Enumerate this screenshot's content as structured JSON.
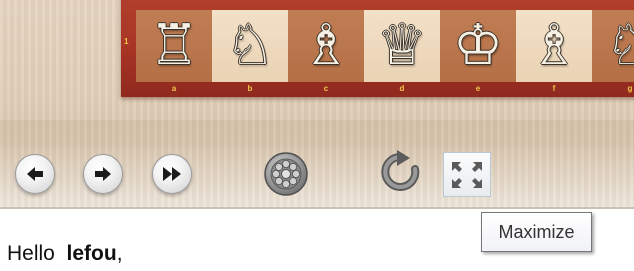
{
  "board": {
    "rank_label": "1",
    "squares": [
      {
        "file": "a",
        "piece": "♖",
        "piece_name": "rook-icon",
        "shade": "dark"
      },
      {
        "file": "b",
        "piece": "♘",
        "piece_name": "knight-icon",
        "shade": "light"
      },
      {
        "file": "c",
        "piece": "♗",
        "piece_name": "bishop-icon",
        "shade": "dark"
      },
      {
        "file": "d",
        "piece": "♕",
        "piece_name": "queen-icon",
        "shade": "light"
      },
      {
        "file": "e",
        "piece": "♔",
        "piece_name": "king-icon",
        "shade": "dark"
      },
      {
        "file": "f",
        "piece": "♗",
        "piece_name": "bishop-icon",
        "shade": "light"
      },
      {
        "file": "g",
        "piece": "♘",
        "piece_name": "knight-icon",
        "shade": "dark"
      }
    ]
  },
  "toolbar": {
    "buttons": [
      {
        "name": "back-button",
        "icon": "arrow-left-icon"
      },
      {
        "name": "forward-button",
        "icon": "arrow-right-icon"
      },
      {
        "name": "fast-forward-button",
        "icon": "fast-forward-icon"
      },
      {
        "name": "options-wheel-button",
        "icon": "wheel-icon"
      },
      {
        "name": "flip-board-button",
        "icon": "rotate-icon"
      },
      {
        "name": "maximize-button",
        "icon": "maximize-icon"
      }
    ]
  },
  "tooltip": {
    "text": "Maximize"
  },
  "greeting": {
    "prefix": "Hello",
    "username": "lefou",
    "suffix": ","
  },
  "colors": {
    "board_frame": "#a83425",
    "label_gold": "#f1c64a",
    "dark_square": "#b46f45",
    "light_square": "#ead3b4"
  }
}
